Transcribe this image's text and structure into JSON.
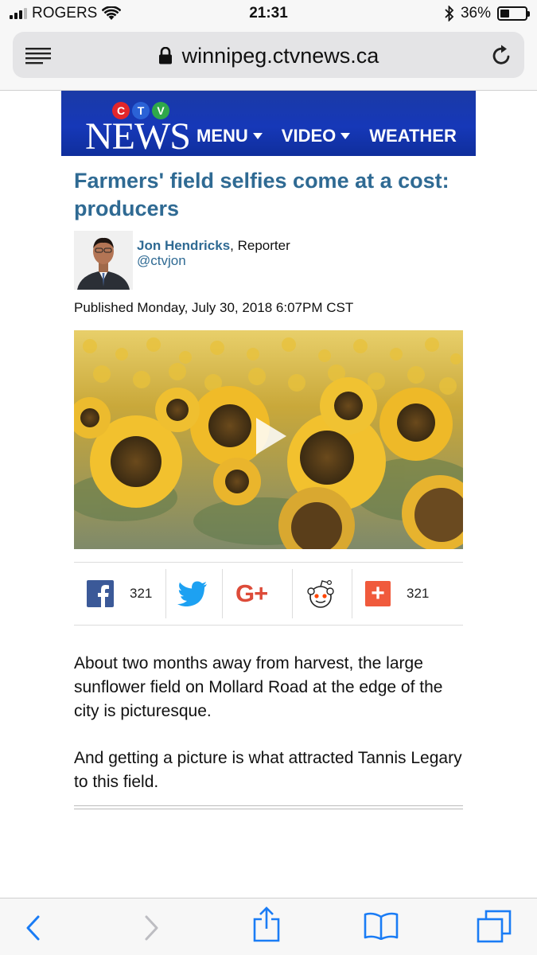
{
  "status_bar": {
    "carrier": "ROGERS",
    "time": "21:31",
    "battery_percent": "36%",
    "battery_level": 0.36
  },
  "browser": {
    "url": "winnipeg.ctvnews.ca"
  },
  "site_header": {
    "logo_letters": [
      "C",
      "T",
      "V"
    ],
    "logo_word": "NEWS",
    "nav": [
      "MENU",
      "VIDEO",
      "WEATHER"
    ]
  },
  "article": {
    "headline": "Farmers' field selfies come at a cost: producers",
    "author_name": "Jon Hendricks",
    "author_role": ", Reporter",
    "author_handle": "@ctvjon",
    "published": "Published Monday, July 30, 2018 6:07PM CST",
    "paragraphs": [
      "About two months away from harvest, the large sunflower field on Mollard Road at the edge of the city is picturesque.",
      "And getting a picture is what attracted Tannis Legary to this field."
    ]
  },
  "share": {
    "facebook_count": "321",
    "total_count": "321",
    "plus_symbol": "+",
    "gplus_label": "G+"
  },
  "colors": {
    "headline": "#2f6a93",
    "header_blue": "#1638b8",
    "ios_blue": "#1a7cf5",
    "facebook": "#3b5998",
    "twitter": "#1da1f2",
    "gplus": "#dd4b39",
    "addthis": "#f05a3c"
  },
  "icons": {
    "reader": "reader-mode-icon",
    "lock": "lock-icon",
    "reload": "reload-icon",
    "back": "back-chevron-icon",
    "forward": "forward-chevron-icon",
    "share": "share-icon",
    "bookmarks": "bookmarks-icon",
    "tabs": "tabs-icon"
  }
}
